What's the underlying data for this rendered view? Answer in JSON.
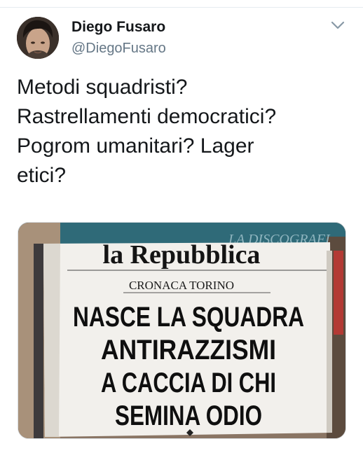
{
  "tweet": {
    "author": {
      "display_name": "Diego Fusaro",
      "handle": "@DiegoFusaro"
    },
    "text_lines": [
      "Metodi squadristi?",
      "Rastrellamenti democratici?",
      "Pogrom umanitari? Lager",
      "etici?"
    ],
    "media": {
      "background_sign": "LA DISCOGRAFI",
      "masthead": "la Repubblica",
      "section": "CRONACA TORINO",
      "headline_lines": [
        "NASCE LA SQUADRA",
        "ANTIRAZZISMI",
        "A CACCIA DI CHI",
        "SEMINA ODIO"
      ]
    }
  },
  "icons": {
    "caret": "chevron-down-icon"
  },
  "colors": {
    "text": "#14171a",
    "secondary": "#657786",
    "paper": "#f4f2ee"
  }
}
